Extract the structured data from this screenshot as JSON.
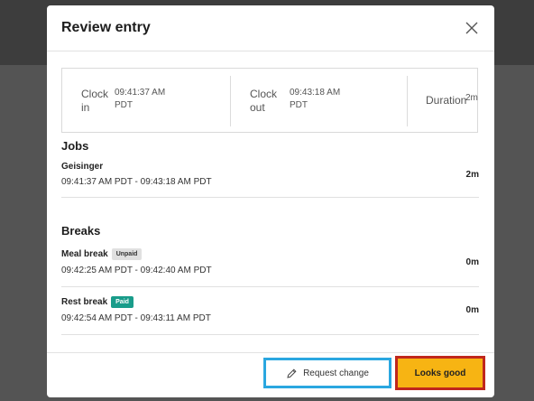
{
  "modal": {
    "title": "Review entry"
  },
  "summary": {
    "clock_in_label": [
      "Clock",
      "in"
    ],
    "clock_in_value": [
      "09:41:37 AM",
      "PDT"
    ],
    "clock_out_label": [
      "Clock",
      "out"
    ],
    "clock_out_value": [
      "09:43:18 AM",
      "PDT"
    ],
    "duration_label": "Duration",
    "duration_value": "2m"
  },
  "jobs": {
    "title": "Jobs",
    "items": [
      {
        "name": "Geisinger",
        "time": "09:41:37 AM PDT - 09:43:18 AM PDT",
        "duration": "2m"
      }
    ]
  },
  "breaks": {
    "title": "Breaks",
    "items": [
      {
        "name": "Meal break",
        "badge": "Unpaid",
        "time": "09:42:25 AM PDT - 09:42:40 AM PDT",
        "duration": "0m"
      },
      {
        "name": "Rest break",
        "badge": "Paid",
        "time": "09:42:54 AM PDT - 09:43:11 AM PDT",
        "duration": "0m"
      }
    ]
  },
  "footer": {
    "request_label": "Request change",
    "looks_good_label": "Looks good"
  },
  "colors": {
    "accent": "#f7b413",
    "request_outline": "#2aa7e0",
    "looks_outline": "#c0271c",
    "paid_badge": "#199c8a"
  },
  "icons": {
    "close": "close-icon",
    "pencil": "pencil-icon"
  }
}
